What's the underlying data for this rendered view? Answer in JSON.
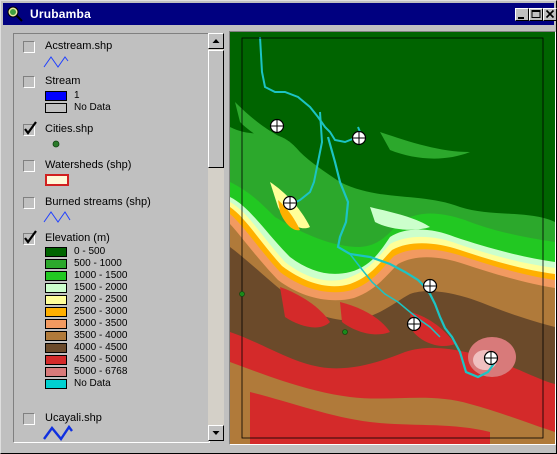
{
  "window": {
    "title": "Urubamba"
  },
  "colors": {
    "titlebar": "#000080",
    "elev_0_500": "#006400",
    "elev_500_1000": "#2ca82c",
    "elev_1000_1500": "#22c822",
    "elev_1500_2000": "#ccffcc",
    "elev_2000_2500": "#ffff99",
    "elev_2500_3000": "#ffb000",
    "elev_3000_3500": "#f29a60",
    "elev_3500_4000": "#b07a3a",
    "elev_4000_4500": "#6b4a2a",
    "elev_4500_5000": "#d42a2a",
    "elev_5000_6768": "#d87a7a",
    "elev_nodata": "#00d0d0",
    "river": "#1cc4c4"
  },
  "toc": {
    "layers": [
      {
        "name": "Acstream.shp",
        "checked": false,
        "symbol": "line-icon"
      },
      {
        "name": "Stream",
        "checked": false,
        "legend": [
          {
            "label": "1",
            "color": "#0000ff"
          },
          {
            "label": "No Data",
            "color": "#c0c0c0"
          }
        ]
      },
      {
        "name": "Cities.shp",
        "checked": true,
        "symbol": "point-icon"
      },
      {
        "name": "Watersheds (shp)",
        "checked": false,
        "symbol": "polygon-icon"
      },
      {
        "name": "Burned streams (shp)",
        "checked": false,
        "symbol": "line-icon"
      },
      {
        "name": "Elevation (m)",
        "checked": true,
        "legend": [
          {
            "label": "0 - 500",
            "color": "#006400"
          },
          {
            "label": "500 - 1000",
            "color": "#2ca82c"
          },
          {
            "label": "1000 - 1500",
            "color": "#22c822"
          },
          {
            "label": "1500 - 2000",
            "color": "#ccffcc"
          },
          {
            "label": "2000 - 2500",
            "color": "#ffff99"
          },
          {
            "label": "2500 - 3000",
            "color": "#ffb000"
          },
          {
            "label": "3000 - 3500",
            "color": "#f29a60"
          },
          {
            "label": "3500 - 4000",
            "color": "#b07a3a"
          },
          {
            "label": "4000 - 4500",
            "color": "#6b4a2a"
          },
          {
            "label": "4500 - 5000",
            "color": "#d42a2a"
          },
          {
            "label": "5000 - 6768",
            "color": "#d87a7a"
          },
          {
            "label": "No Data",
            "color": "#00d0d0"
          }
        ]
      },
      {
        "name": "Ucayali.shp",
        "checked": false,
        "symbol": "line-icon"
      }
    ]
  }
}
